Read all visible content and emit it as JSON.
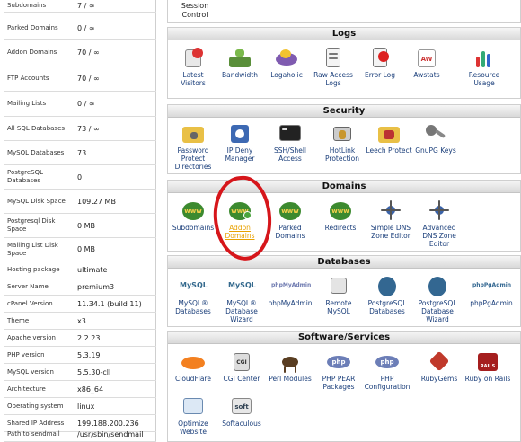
{
  "stats": [
    {
      "label": "Subdomains",
      "value": "7 / ∞"
    },
    {
      "label": "Parked Domains",
      "value": "0 / ∞"
    },
    {
      "label": "Addon Domains",
      "value": "70 / ∞"
    },
    {
      "label": "FTP Accounts",
      "value": "70 / ∞"
    },
    {
      "label": "Mailing Lists",
      "value": "0 / ∞"
    },
    {
      "label": "All SQL Databases",
      "value": "73 / ∞"
    },
    {
      "label": "MySQL Databases",
      "value": "73"
    },
    {
      "label": "PostgreSQL Databases",
      "value": "0"
    },
    {
      "label": "MySQL Disk Space",
      "value": "109.27 MB"
    },
    {
      "label": "Postgresql Disk Space",
      "value": "0 MB"
    },
    {
      "label": "Mailing List Disk Space",
      "value": "0 MB"
    },
    {
      "label": "Hosting package",
      "value": "ultimate"
    },
    {
      "label": "Server Name",
      "value": "premium3"
    },
    {
      "label": "cPanel Version",
      "value": "11.34.1 (build 11)"
    },
    {
      "label": "Theme",
      "value": "x3"
    },
    {
      "label": "Apache version",
      "value": "2.2.23"
    },
    {
      "label": "PHP version",
      "value": "5.3.19"
    },
    {
      "label": "MySQL version",
      "value": "5.5.30-cll"
    },
    {
      "label": "Architecture",
      "value": "x86_64"
    },
    {
      "label": "Operating system",
      "value": "linux"
    },
    {
      "label": "Shared IP Address",
      "value": "199.188.200.236"
    },
    {
      "label": "Path to sendmail",
      "value": "/usr/sbin/sendmail"
    }
  ],
  "top_label": "Session Control",
  "sections": {
    "logs": {
      "title": "Logs",
      "items": [
        "Latest Visitors",
        "Bandwidth",
        "Logaholic",
        "Raw Access Logs",
        "Error Log",
        "Awstats",
        "Resource Usage"
      ]
    },
    "security": {
      "title": "Security",
      "items": [
        "Password Protect Directories",
        "IP Deny Manager",
        "SSH/Shell Access",
        "HotLink Protection",
        "Leech Protect",
        "GnuPG Keys"
      ]
    },
    "domains": {
      "title": "Domains",
      "items": [
        "Subdomains",
        "Addon Domains",
        "Parked Domains",
        "Redirects",
        "Simple DNS Zone Editor",
        "Advanced DNS Zone Editor"
      ]
    },
    "databases": {
      "title": "Databases",
      "items": [
        "MySQL® Databases",
        "MySQL® Database Wizard",
        "phpMyAdmin",
        "Remote MySQL",
        "PostgreSQL Databases",
        "PostgreSQL Database Wizard",
        "phpPgAdmin"
      ]
    },
    "software": {
      "title": "Software/Services",
      "items": [
        "CloudFlare",
        "CGI Center",
        "Perl Modules",
        "PHP PEAR Packages",
        "PHP Configuration",
        "RubyGems",
        "Ruby on Rails",
        "Optimize Website",
        "Softaculous"
      ]
    }
  },
  "icon_text": {
    "www": "www",
    "cgi": "CGI",
    "php": "php",
    "soft": "soft",
    "rails": "RAILS",
    "mysql": "MySQL",
    "phpmyadmin": "phpMyAdmin",
    "phppgadmin": "phpPgAdmin",
    "awstats": "AW"
  },
  "colors": {
    "link": "#1a3e7a",
    "highlight": "#e8a100",
    "annotation": "#d6161b"
  }
}
